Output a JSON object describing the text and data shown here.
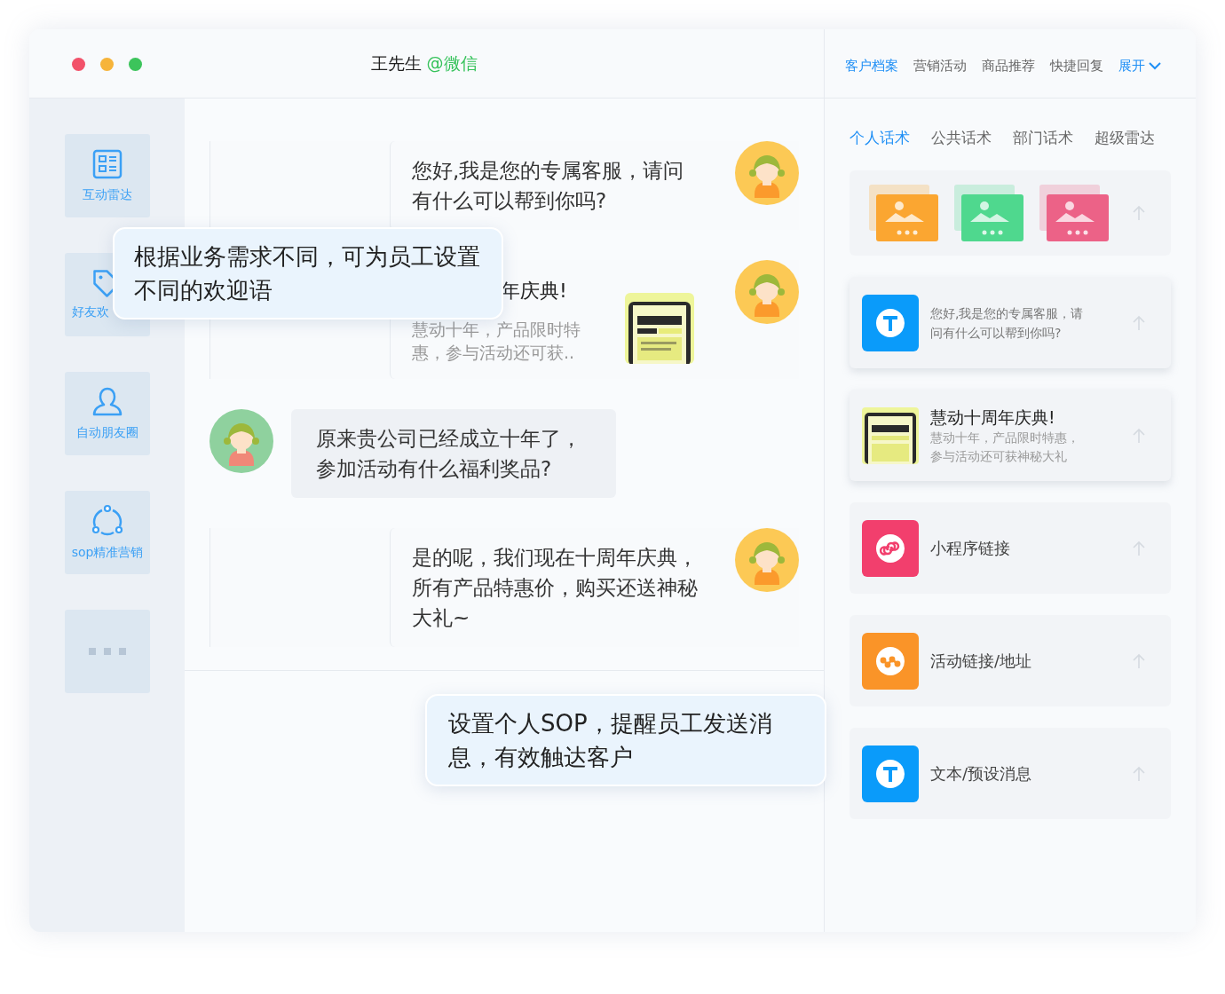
{
  "window": {
    "title": "王先生",
    "channel": "@微信"
  },
  "sidebar": {
    "items": [
      {
        "kind": "radar",
        "label": "互动雷达"
      },
      {
        "kind": "tag",
        "label": "好友欢"
      },
      {
        "kind": "person",
        "label": "自动朋友圈"
      },
      {
        "kind": "cycle",
        "label": "sop精准营销"
      },
      {
        "kind": "more"
      }
    ]
  },
  "messages": [
    {
      "incoming": false,
      "kind": "text",
      "text": "您好,我是您的专属客服，请问有什么可以帮到你吗?"
    },
    {
      "incoming": false,
      "kind": "card",
      "title": "年庆典!",
      "text": "慧动十年，产品限时特惠，参与活动还可获.."
    },
    {
      "incoming": true,
      "kind": "text",
      "text": "原来贵公司已经成立十年了，参加活动有什么福利奖品?"
    },
    {
      "incoming": false,
      "kind": "text",
      "text": "是的呢，我们现在十周年庆典，所有产品特惠价，购买还送神秘大礼~"
    }
  ],
  "callouts": [
    {
      "kind": "welcome",
      "text": "根据业务需求不同，可为员工设置不同的欢迎语"
    },
    {
      "kind": "sop",
      "text": "设置个人SOP，提醒员工发送消息，有效触达客户"
    }
  ],
  "top_tabs": [
    {
      "label": "客户档案",
      "selected": true
    },
    {
      "label": "营销活动",
      "selected": false
    },
    {
      "label": "商品推荐",
      "selected": false
    },
    {
      "label": "快捷回复",
      "selected": false
    }
  ],
  "expand": "展开",
  "sub_tabs": [
    {
      "label": "个人话术",
      "selected": true
    },
    {
      "label": "公共话术",
      "selected": false
    },
    {
      "label": "部门话术",
      "selected": false
    },
    {
      "label": "超级雷达",
      "selected": false
    }
  ],
  "snippets": [
    {
      "kind": "images",
      "raised": false,
      "images": [
        {
          "color": "#fba631"
        },
        {
          "color": "#4fd88e"
        },
        {
          "color": "#ec6287"
        }
      ]
    },
    {
      "kind": "text",
      "raised": true,
      "text": "您好,我是您的专属客服，请问有什么可以帮到你吗?"
    },
    {
      "kind": "article",
      "raised": true,
      "title": "慧动十周年庆典!",
      "text": "慧动十年，产品限时特惠，参与活动还可获神秘大礼"
    },
    {
      "kind": "miniprogram",
      "raised": false,
      "label": "小程序链接"
    },
    {
      "kind": "link",
      "raised": false,
      "label": "活动链接/地址"
    },
    {
      "kind": "text",
      "raised": false,
      "label": "文本/预设消息"
    }
  ]
}
